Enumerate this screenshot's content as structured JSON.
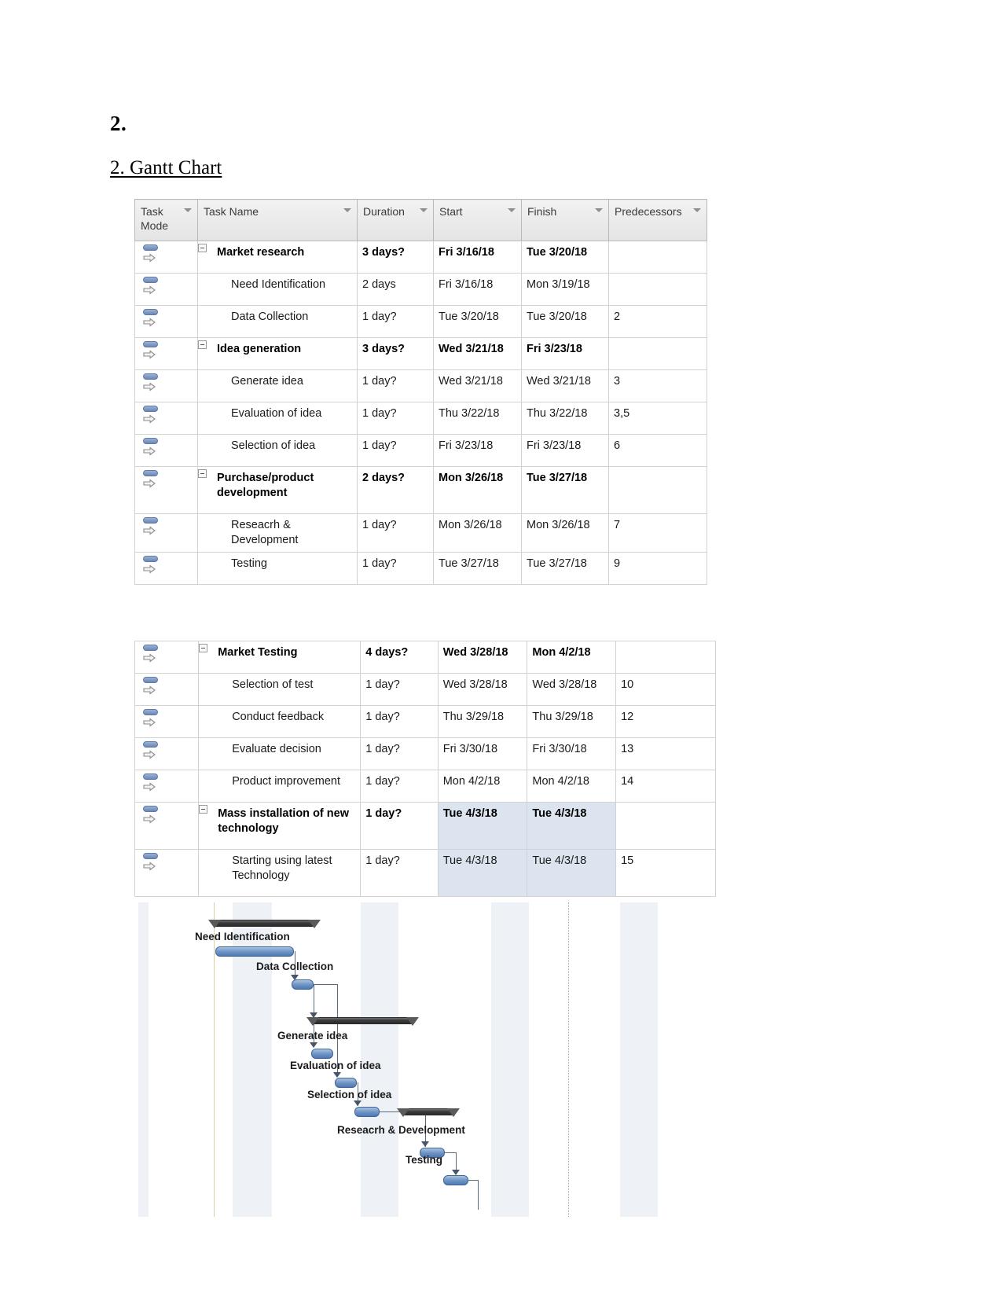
{
  "document": {
    "heading": "2.",
    "subheading": "2. Gantt Chart"
  },
  "table": {
    "columns": [
      {
        "key": "mode",
        "label": "Task\nMode"
      },
      {
        "key": "name",
        "label": "Task Name"
      },
      {
        "key": "dur",
        "label": "Duration"
      },
      {
        "key": "start",
        "label": "Start"
      },
      {
        "key": "finish",
        "label": "Finish"
      },
      {
        "key": "pred",
        "label": "Predecessors"
      }
    ],
    "header": {
      "task_mode": "Task Mode",
      "task_mode_l1": "Task",
      "task_mode_l2": "Mode",
      "task_name": "Task Name",
      "duration": "Duration",
      "start": "Start",
      "finish": "Finish",
      "predecessors": "Predecessors"
    }
  },
  "table1_rows": [
    {
      "name": "Market research",
      "dur": "3 days?",
      "start": "Fri 3/16/18",
      "finish": "Tue 3/20/18",
      "pred": "",
      "summary": true,
      "level": 1
    },
    {
      "name": "Need Identification",
      "dur": "2 days",
      "start": "Fri 3/16/18",
      "finish": "Mon 3/19/18",
      "pred": "",
      "summary": false,
      "level": 2
    },
    {
      "name": "Data Collection",
      "dur": "1 day?",
      "start": "Tue 3/20/18",
      "finish": "Tue 3/20/18",
      "pred": "2",
      "summary": false,
      "level": 2
    },
    {
      "name": "Idea generation",
      "dur": "3 days?",
      "start": "Wed 3/21/18",
      "finish": "Fri 3/23/18",
      "pred": "",
      "summary": true,
      "level": 1
    },
    {
      "name": "Generate idea",
      "dur": "1 day?",
      "start": "Wed 3/21/18",
      "finish": "Wed 3/21/18",
      "pred": "3",
      "summary": false,
      "level": 2
    },
    {
      "name": "Evaluation of idea",
      "dur": "1 day?",
      "start": "Thu 3/22/18",
      "finish": "Thu 3/22/18",
      "pred": "3,5",
      "summary": false,
      "level": 2
    },
    {
      "name": "Selection of idea",
      "dur": "1 day?",
      "start": "Fri 3/23/18",
      "finish": "Fri 3/23/18",
      "pred": "6",
      "summary": false,
      "level": 2
    },
    {
      "name": "Purchase/product development",
      "dur": "2 days?",
      "start": "Mon 3/26/18",
      "finish": "Tue 3/27/18",
      "pred": "",
      "summary": true,
      "level": 1
    },
    {
      "name": "Reseacrh & Development",
      "dur": "1 day?",
      "start": "Mon 3/26/18",
      "finish": "Mon 3/26/18",
      "pred": "7",
      "summary": false,
      "level": 2
    },
    {
      "name": "Testing",
      "dur": "1 day?",
      "start": "Tue 3/27/18",
      "finish": "Tue 3/27/18",
      "pred": "9",
      "summary": false,
      "level": 2
    }
  ],
  "table2_rows": [
    {
      "name": "Market Testing",
      "dur": "4 days?",
      "start": "Wed 3/28/18",
      "finish": "Mon 4/2/18",
      "pred": "",
      "summary": true,
      "level": 1,
      "selected": false
    },
    {
      "name": "Selection of test",
      "dur": "1 day?",
      "start": "Wed 3/28/18",
      "finish": "Wed 3/28/18",
      "pred": "10",
      "summary": false,
      "level": 2,
      "selected": false
    },
    {
      "name": "Conduct feedback",
      "dur": "1 day?",
      "start": "Thu 3/29/18",
      "finish": "Thu 3/29/18",
      "pred": "12",
      "summary": false,
      "level": 2,
      "selected": false
    },
    {
      "name": "Evaluate decision",
      "dur": "1 day?",
      "start": "Fri 3/30/18",
      "finish": "Fri 3/30/18",
      "pred": "13",
      "summary": false,
      "level": 2,
      "selected": false
    },
    {
      "name": "Product improvement",
      "dur": "1 day?",
      "start": "Mon 4/2/18",
      "finish": "Mon 4/2/18",
      "pred": "14",
      "summary": false,
      "level": 2,
      "selected": false
    },
    {
      "name": "Mass installation of new technology",
      "dur": "1 day?",
      "start": "Tue 4/3/18",
      "finish": "Tue 4/3/18",
      "pred": "",
      "summary": true,
      "level": 1,
      "selected": true
    },
    {
      "name": "Starting using latest Technology",
      "dur": "1 day?",
      "start": "Tue 4/3/18",
      "finish": "Tue 4/3/18",
      "pred": "15",
      "summary": false,
      "level": 2,
      "selected": true
    }
  ],
  "chart_data": {
    "type": "bar",
    "title": "Gantt Chart",
    "xlabel": "",
    "ylabel": "",
    "bar_labels": [
      "Need Identification",
      "Data Collection",
      "Generate idea",
      "Evaluation of idea",
      "Selection of idea",
      "Reseacrh & Development",
      "Testing"
    ],
    "bars": [
      {
        "label": "Market research",
        "kind": "summary",
        "start": "Fri 3/16/18",
        "finish": "Tue 3/20/18",
        "duration": "3 days?"
      },
      {
        "label": "Need Identification",
        "kind": "task",
        "start": "Fri 3/16/18",
        "finish": "Mon 3/19/18",
        "duration": "2 days"
      },
      {
        "label": "Data Collection",
        "kind": "task",
        "start": "Tue 3/20/18",
        "finish": "Tue 3/20/18",
        "duration": "1 day?"
      },
      {
        "label": "Idea generation",
        "kind": "summary",
        "start": "Wed 3/21/18",
        "finish": "Fri 3/23/18",
        "duration": "3 days?"
      },
      {
        "label": "Generate idea",
        "kind": "task",
        "start": "Wed 3/21/18",
        "finish": "Wed 3/21/18",
        "duration": "1 day?"
      },
      {
        "label": "Evaluation of idea",
        "kind": "task",
        "start": "Thu 3/22/18",
        "finish": "Thu 3/22/18",
        "duration": "1 day?"
      },
      {
        "label": "Selection of idea",
        "kind": "task",
        "start": "Fri 3/23/18",
        "finish": "Fri 3/23/18",
        "duration": "1 day?"
      },
      {
        "label": "Purchase/product development",
        "kind": "summary",
        "start": "Mon 3/26/18",
        "finish": "Tue 3/27/18",
        "duration": "2 days?"
      },
      {
        "label": "Reseacrh & Development",
        "kind": "task",
        "start": "Mon 3/26/18",
        "finish": "Mon 3/26/18",
        "duration": "1 day?"
      },
      {
        "label": "Testing",
        "kind": "task",
        "start": "Tue 3/27/18",
        "finish": "Tue 3/27/18",
        "duration": "1 day?"
      }
    ]
  },
  "colors": {
    "task_bar": "#4e79b2",
    "summary_bar": "#2b2b2b",
    "selection": "#dce5ef",
    "nonworking_band": "#e8ecf1",
    "today_line": "#d8cfa5",
    "link_line": "#5a6b7d",
    "header_bg": "#e4e4e4"
  }
}
